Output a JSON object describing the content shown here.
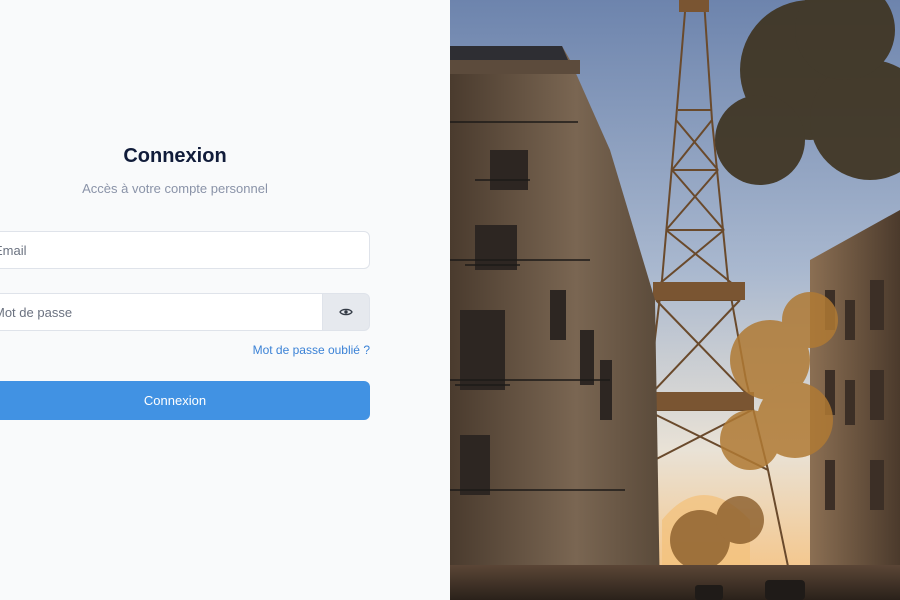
{
  "login": {
    "title": "Connexion",
    "subtitle": "Accès à votre compte personnel",
    "email_placeholder": "Email",
    "password_placeholder": "Mot de passe",
    "forgot_label": "Mot de passe oublié ?",
    "submit_label": "Connexion",
    "toggle_icon": "eye-icon"
  },
  "hero_image": {
    "subject": "eiffel-tower-street-photo"
  },
  "colors": {
    "accent": "#4192e3",
    "link": "#3b82d6",
    "title": "#111c3a",
    "muted": "#8a93a8"
  }
}
